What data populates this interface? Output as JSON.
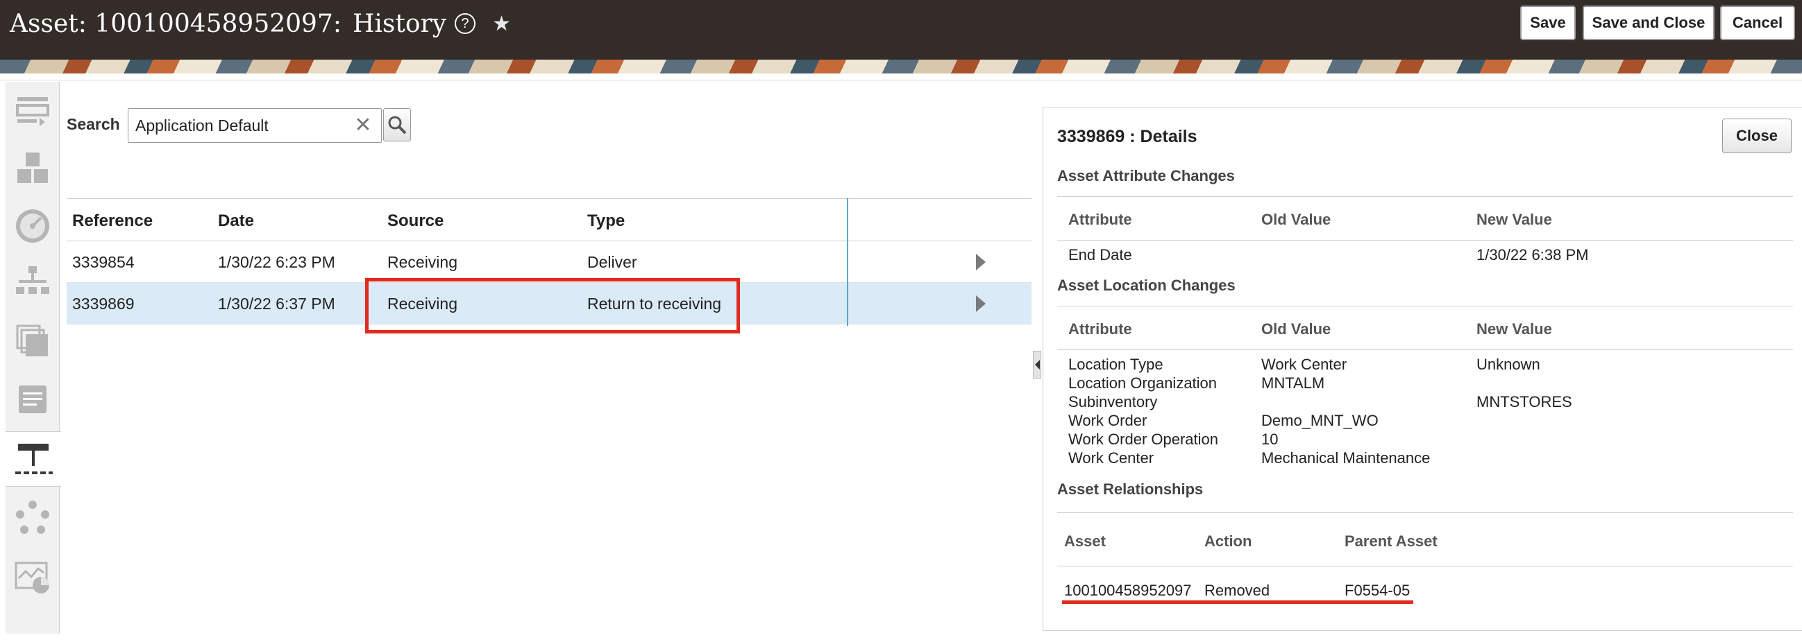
{
  "header": {
    "title_prefix": "Asset: 100100458952097:",
    "title_page": "History",
    "help_icon": "?",
    "star_icon": "★",
    "save_label": "Save",
    "save_close_label": "Save and Close",
    "cancel_label": "Cancel"
  },
  "rail": {
    "icons": [
      "form-icon",
      "blocks-icon",
      "gauge-icon",
      "hierarchy-icon",
      "copy-icon",
      "document-icon",
      "history-tree-icon",
      "cycle-icon",
      "map-chart-icon"
    ],
    "active": "history-tree-icon"
  },
  "search": {
    "label": "Search",
    "value": "Application Default",
    "clear_icon": "✕"
  },
  "history": {
    "columns": [
      "Reference",
      "Date",
      "Source",
      "Type"
    ],
    "rows": [
      {
        "reference": "3339854",
        "date": "1/30/22 6:23 PM",
        "source": "Receiving",
        "type": "Deliver"
      },
      {
        "reference": "3339869",
        "date": "1/30/22 6:37 PM",
        "source": "Receiving",
        "type": "Return to receiving"
      }
    ],
    "selected_row": 1
  },
  "details": {
    "title": "3339869 : Details",
    "close_label": "Close",
    "attribute_changes": {
      "title": "Asset Attribute Changes",
      "columns": [
        "Attribute",
        "Old Value",
        "New Value"
      ],
      "rows": [
        {
          "attribute": "End Date",
          "old": "",
          "new": "1/30/22 6:38 PM"
        }
      ]
    },
    "location_changes": {
      "title": "Asset Location Changes",
      "columns": [
        "Attribute",
        "Old Value",
        "New Value"
      ],
      "rows": [
        {
          "attribute": "Location Type",
          "old": "Work Center",
          "new": "Unknown"
        },
        {
          "attribute": "Location Organization",
          "old": "MNTALM",
          "new": ""
        },
        {
          "attribute": "Subinventory",
          "old": "",
          "new": "MNTSTORES"
        },
        {
          "attribute": "Work Order",
          "old": "Demo_MNT_WO",
          "new": ""
        },
        {
          "attribute": "Work Order Operation",
          "old": "10",
          "new": ""
        },
        {
          "attribute": "Work Center",
          "old": "Mechanical Maintenance",
          "new": ""
        }
      ]
    },
    "relationships": {
      "title": "Asset Relationships",
      "columns": [
        "Asset",
        "Action",
        "Parent Asset"
      ],
      "rows": [
        {
          "asset": "100100458952097",
          "action": "Removed",
          "parent": "F0554-05"
        }
      ]
    }
  },
  "colors": {
    "header_bg": "#332c28",
    "selected_row": "#dbeaf7",
    "highlight_red": "#e02b20",
    "column_divider": "#5ba6cf"
  }
}
